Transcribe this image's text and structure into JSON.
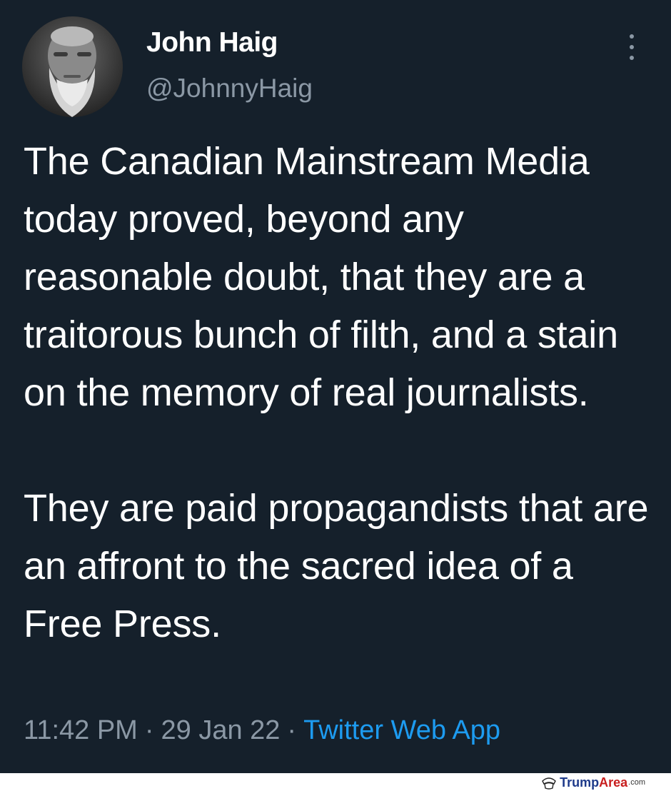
{
  "author": {
    "name": "John Haig",
    "handle": "@JohnnyHaig",
    "avatar_icon": "bearded-man-portrait"
  },
  "menu_icon": "more-vertical-icon",
  "tweet": {
    "paragraph_1": "The Canadian Mainstream Media today proved, beyond any reasonable doubt, that they are a traitorous bunch of filth, and a stain on the memory of real journalists.",
    "paragraph_2": "They are paid propagandists that are an affront to the sacred idea of a Free Press."
  },
  "meta": {
    "time": "11:42 PM",
    "date": "29 Jan 22",
    "separator": "·",
    "source": "Twitter Web App"
  },
  "watermark": {
    "brand_part1": "Trump",
    "brand_part2": "Area",
    "suffix": ".com"
  },
  "colors": {
    "background": "#15202b",
    "text": "#ffffff",
    "secondary": "#8b98a5",
    "link": "#1d9bf0"
  }
}
